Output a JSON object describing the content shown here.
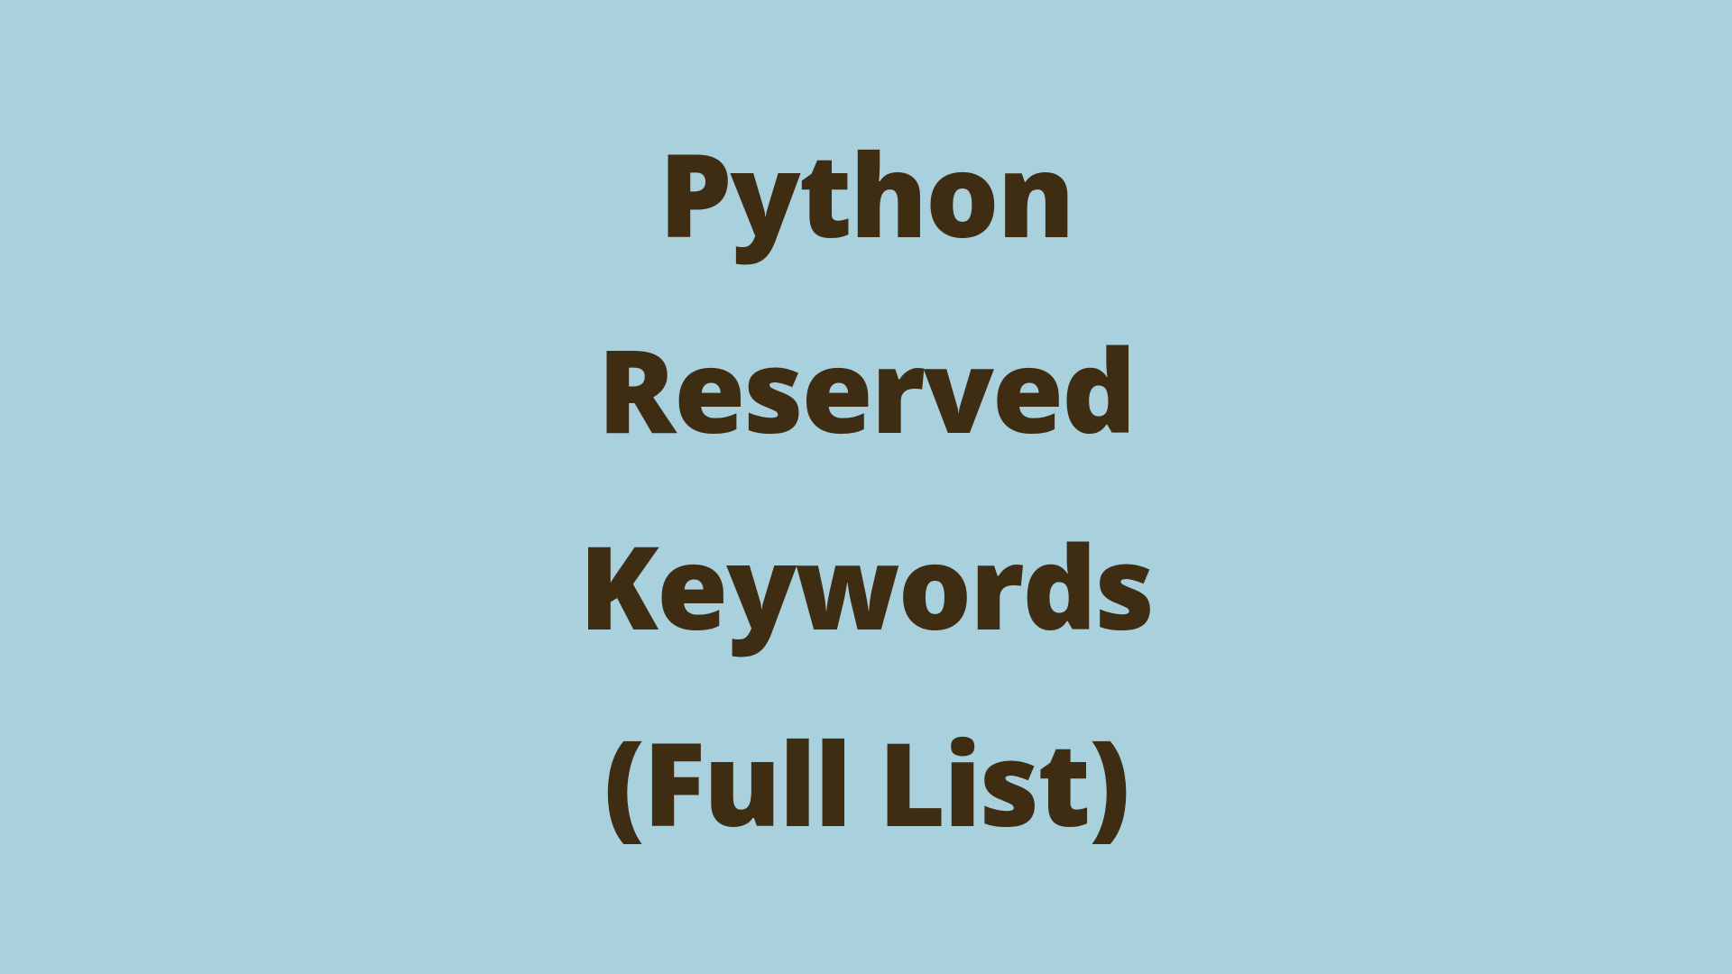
{
  "content": {
    "line1": "Python",
    "line2": "Reserved",
    "line3": "Keywords",
    "line4": "(Full List)"
  },
  "colors": {
    "background": "#a9d0dd",
    "text": "#3e2c13"
  }
}
